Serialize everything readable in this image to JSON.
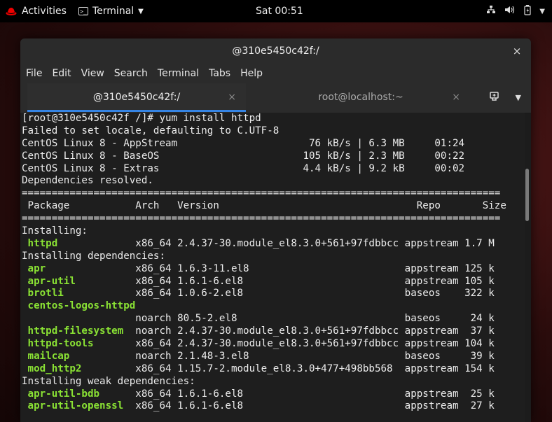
{
  "topbar": {
    "activities": "Activities",
    "app_name": "Terminal",
    "clock": "Sat 00:51",
    "icons": [
      "network-icon",
      "volume-icon",
      "battery-icon",
      "system-menu-chevron-icon"
    ]
  },
  "window": {
    "title": "@310e5450c42f:/",
    "close_glyph": "×",
    "menu": [
      "File",
      "Edit",
      "View",
      "Search",
      "Terminal",
      "Tabs",
      "Help"
    ],
    "tabs": [
      {
        "label": "@310e5450c42f:/",
        "active": true
      },
      {
        "label": "root@localhost:~",
        "active": false
      }
    ]
  },
  "terminal": {
    "lines": [
      "[root@310e5450c42f /]# yum install httpd",
      "Failed to set locale, defaulting to C.UTF-8",
      "CentOS Linux 8 - AppStream                      76 kB/s | 6.3 MB     01:24",
      "CentOS Linux 8 - BaseOS                        105 kB/s | 2.3 MB     00:22",
      "CentOS Linux 8 - Extras                        4.4 kB/s | 9.2 kB     00:02",
      "Dependencies resolved.",
      "================================================================================",
      " Package           Arch   Version                                 Repo       Size",
      "================================================================================",
      "Installing:",
      " httpd             x86_64 2.4.37-30.module_el8.3.0+561+97fdbbcc appstream 1.7 M",
      "Installing dependencies:",
      " apr               x86_64 1.6.3-11.el8                          appstream 125 k",
      " apr-util          x86_64 1.6.1-6.el8                           appstream 105 k",
      " brotli            x86_64 1.0.6-2.el8                           baseos    322 k",
      " centos-logos-httpd",
      "                   noarch 80.5-2.el8                            baseos     24 k",
      " httpd-filesystem  noarch 2.4.37-30.module_el8.3.0+561+97fdbbcc appstream  37 k",
      " httpd-tools       x86_64 2.4.37-30.module_el8.3.0+561+97fdbbcc appstream 104 k",
      " mailcap           noarch 2.1.48-3.el8                          baseos     39 k",
      " mod_http2         x86_64 1.15.7-2.module_el8.3.0+477+498bb568  appstream 154 k",
      "Installing weak dependencies:",
      " apr-util-bdb      x86_64 1.6.1-6.el8                           appstream  25 k",
      " apr-util-openssl  x86_64 1.6.1-6.el8                           appstream  27 k"
    ],
    "package_names": {
      "10": "httpd",
      "12": "apr",
      "13": "apr-util",
      "14": "brotli",
      "15": "centos-logos-httpd",
      "17": "httpd-filesystem",
      "18": "httpd-tools",
      "19": "mailcap",
      "20": "mod_http2",
      "22": "apr-util-bdb",
      "23": "apr-util-openssl"
    },
    "colors": {
      "background": "#1e1e1e",
      "text": "#ececec",
      "package": "#8ae234",
      "tab_accent": "#3584e4"
    }
  }
}
